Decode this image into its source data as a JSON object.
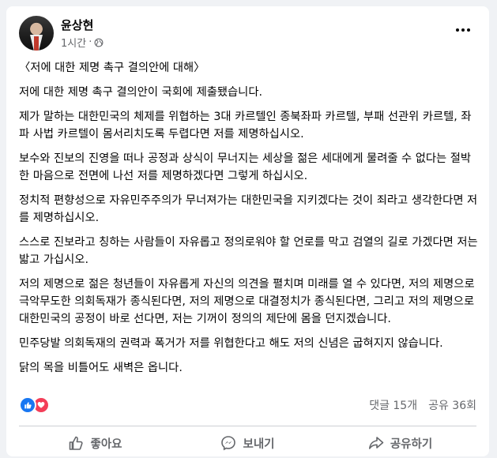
{
  "post": {
    "author": "윤상현",
    "time": "1시간",
    "separator": "·",
    "privacy_icon": "globe-icon",
    "more_icon": "more-dots-icon",
    "paragraphs": [
      "〈저에 대한 제명 촉구 결의안에 대해〉",
      "저에 대한 제명 촉구 결의안이 국회에 제출됐습니다.",
      "제가 말하는 대한민국의 체제를 위협하는 3대 카르텔인 종북좌파 카르텔, 부패 선관위 카르텔, 좌파 사법 카르텔이 몸서리치도록 두렵다면 저를 제명하십시오.",
      "보수와 진보의 진영을 떠나 공정과 상식이 무너지는 세상을 젊은 세대에게 물려줄 수 없다는 절박한 마음으로 전면에 나선 저를 제명하겠다면 그렇게 하십시오.",
      "정치적 편향성으로 자유민주주의가 무너져가는 대한민국을 지키겠다는 것이 죄라고 생각한다면 저를 제명하십시오.",
      "스스로 진보라고 칭하는 사람들이 자유롭고 정의로워야 할 언로를 막고 검열의 길로 가겠다면 저는 밟고 가십시오.",
      "저의 제명으로 젊은 청년들이 자유롭게 자신의 의견을 펼치며 미래를 열 수 있다면, 저의 제명으로 극악무도한 의회독재가 종식된다면, 저의 제명으로 대결정치가 종식된다면, 그리고 저의 제명으로 대한민국의 공정이 바로 선다면, 저는 기꺼이 정의의 제단에 몸을 던지겠습니다.",
      "민주당발 의회독재의 권력과 폭거가 저를 위협한다고 해도 저의 신념은 굽혀지지 않습니다.",
      "닭의 목을 비틀어도 새벽은 옵니다."
    ]
  },
  "reactions": {
    "icons": [
      "like-reaction-icon",
      "love-reaction-icon"
    ],
    "comments": "댓글 15개",
    "shares": "공유 36회"
  },
  "actions": {
    "like": "좋아요",
    "send": "보내기",
    "share": "공유하기"
  },
  "colors": {
    "like_blue": "#1877f2",
    "love_red": "#f33e58",
    "secondary_text": "#65676b",
    "background": "#f0f2f5"
  }
}
